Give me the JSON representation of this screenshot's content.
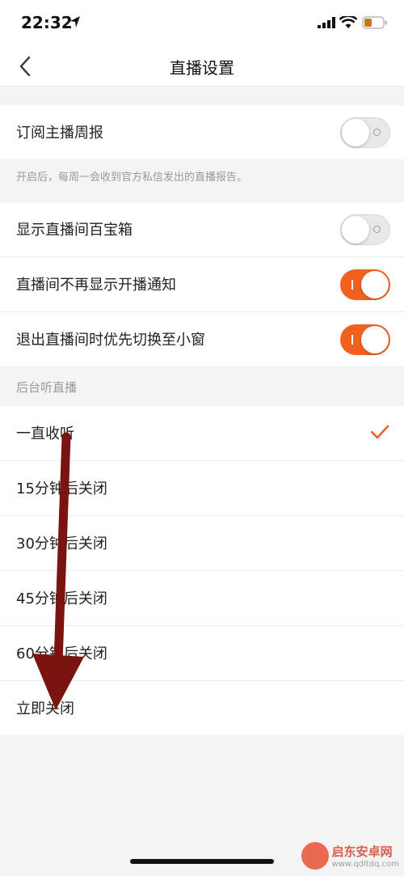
{
  "status_bar": {
    "time": "22:32"
  },
  "nav": {
    "title": "直播设置"
  },
  "weekly_report": {
    "label": "订阅主播周报",
    "on": false
  },
  "hint": "开启后，每周一会收到官方私信发出的直播报告。",
  "settings": [
    {
      "label": "显示直播间百宝箱",
      "on": false
    },
    {
      "label": "直播间不再显示开播通知",
      "on": true
    },
    {
      "label": "退出直播间时优先切换至小窗",
      "on": true
    }
  ],
  "background_listen": {
    "header": "后台听直播",
    "options": [
      {
        "label": "一直收听",
        "selected": true
      },
      {
        "label": "15分钟后关闭",
        "selected": false
      },
      {
        "label": "30分钟后关闭",
        "selected": false
      },
      {
        "label": "45分钟后关闭",
        "selected": false
      },
      {
        "label": "60分钟后关闭",
        "selected": false
      },
      {
        "label": "立即关闭",
        "selected": false
      }
    ]
  },
  "watermark": {
    "name": "启东安卓网",
    "url": "www.qdltdq.com"
  },
  "colors": {
    "accent": "#f2601e",
    "annotation_arrow": "#7a1410"
  }
}
